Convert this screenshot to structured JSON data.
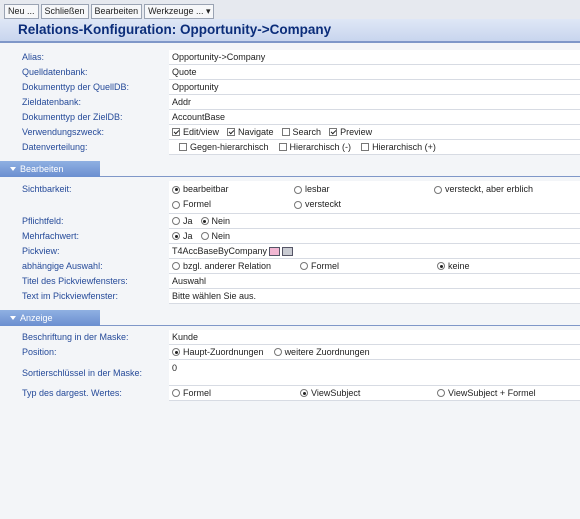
{
  "toolbar": {
    "new_label": "Neu ...",
    "close_label": "Schließen",
    "edit_label": "Bearbeiten",
    "tools_label": "Werkzeuge ... ▾"
  },
  "title": "Relations-Konfiguration: Opportunity->Company",
  "general": {
    "alias_label": "Alias:",
    "alias_value": "Opportunity->Company",
    "source_db_label": "Quelldatenbank:",
    "source_db_value": "Quote",
    "doc_type_source_label": "Dokumenttyp der QuellDB:",
    "doc_type_source_value": "Opportunity",
    "target_db_label": "Zieldatenbank:",
    "target_db_value": "Addr",
    "doc_type_target_label": "Dokumenttyp der ZielDB:",
    "doc_type_target_value": "AccountBase",
    "usage_label": "Verwendungszweck:",
    "usage_options": [
      "Edit/view",
      "Navigate",
      "Search",
      "Preview"
    ],
    "usage_checked": [
      true,
      true,
      false,
      true
    ],
    "data_dist_label": "Datenverteilung:",
    "data_dist_options": [
      "Gegen-hierarchisch",
      "Hierarchisch (-)",
      "Hierarchisch (+)"
    ],
    "data_dist_checked": [
      false,
      false,
      false
    ]
  },
  "section_edit": {
    "header": "Bearbeiten",
    "visibility_label": "Sichtbarkeit:",
    "visibility_options": [
      "bearbeitbar",
      "lesbar",
      "versteckt, aber erblich",
      "Formel",
      "versteckt"
    ],
    "visibility_selected": 0,
    "required_label": "Pflichtfeld:",
    "required_options": [
      "Ja",
      "Nein"
    ],
    "required_selected": 1,
    "multi_label": "Mehrfachwert:",
    "multi_options": [
      "Ja",
      "Nein"
    ],
    "multi_selected": 0,
    "pickview_label": "Pickview:",
    "pickview_value": "T4AccBaseByCompany",
    "dependent_label": "abhängige Auswahl:",
    "dependent_options": [
      "bzgl. anderer Relation",
      "Formel",
      "keine"
    ],
    "dependent_selected": 2,
    "pick_title_label": "Titel des Pickviewfensters:",
    "pick_title_value": "Auswahl",
    "pick_text_label": "Text im Pickviewfenster:",
    "pick_text_value": "Bitte wählen Sie aus."
  },
  "section_display": {
    "header": "Anzeige",
    "caption_label": "Beschriftung in der Maske:",
    "caption_value": "Kunde",
    "position_label": "Position:",
    "position_options": [
      "Haupt-Zuordnungen",
      "weitere Zuordnungen"
    ],
    "position_selected": 0,
    "sort_label": "Sortierschlüssel in der Maske:",
    "sort_value": "0",
    "type_label": "Typ des dargest. Wertes:",
    "type_options": [
      "Formel",
      "ViewSubject",
      "ViewSubject + Formel"
    ],
    "type_selected": 1
  }
}
